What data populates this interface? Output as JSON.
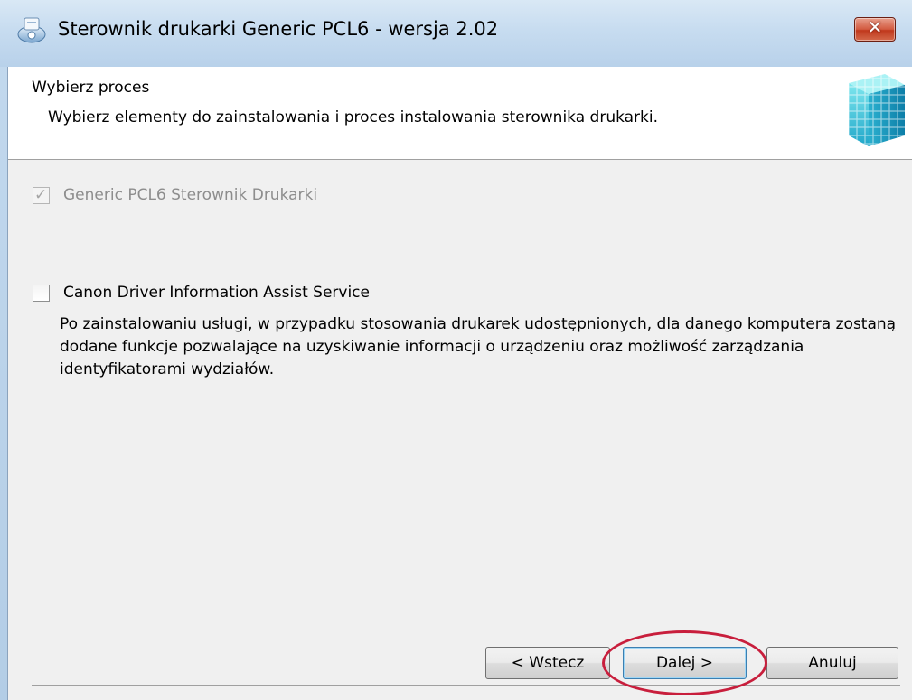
{
  "window": {
    "title": "Sterownik drukarki Generic PCL6 - wersja 2.02",
    "close_label": "✕"
  },
  "header": {
    "title": "Wybierz proces",
    "subtitle": "Wybierz elementy do zainstalowania i proces instalowania sterownika drukarki."
  },
  "options": [
    {
      "label": "Generic PCL6 Sterownik Drukarki",
      "checked": true,
      "enabled": false
    },
    {
      "label": "Canon Driver Information Assist Service",
      "checked": false,
      "enabled": true
    }
  ],
  "option2_description": "Po zainstalowaniu usługi, w przypadku stosowania drukarek udostępnionych, dla danego komputera zostaną dodane funkcje pozwalające na uzyskiwanie informacji o urządzeniu oraz możliwość zarządzania identyfikatorami wydziałów.",
  "buttons": {
    "back": "< Wstecz",
    "next": "Dalej >",
    "cancel": "Anuluj"
  },
  "colors": {
    "highlight_circle": "#c81e3c",
    "titlebar": "#c7dcf0",
    "close_button": "#c0381c"
  },
  "icons": {
    "app": "printer-setup-icon",
    "header": "cube-grid-icon",
    "close": "close-icon"
  }
}
